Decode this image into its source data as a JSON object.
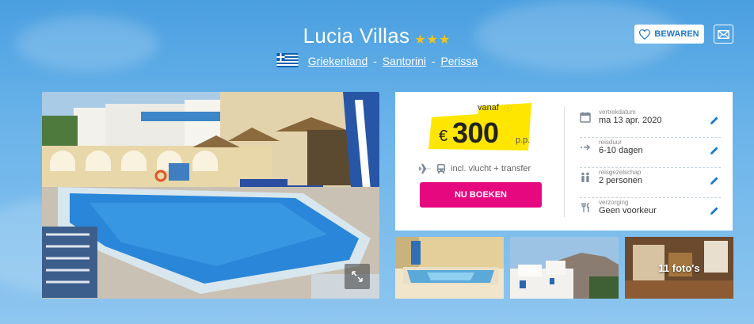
{
  "hotel": {
    "name": "Lucia Villas",
    "stars": "★★★",
    "location": {
      "country": "Griekenland",
      "region": "Santorini",
      "city": "Perissa",
      "separator": "-"
    }
  },
  "actions": {
    "save_label": "BEWAREN"
  },
  "price": {
    "from_label": "vanaf",
    "currency": "€",
    "amount": "300",
    "unit": "p.p.",
    "includes": "incl. vlucht + transfer",
    "book_label": "NU BOEKEN"
  },
  "details": [
    {
      "icon": "calendar-icon",
      "label": "vertrekdatum",
      "value": "ma 13 apr. 2020"
    },
    {
      "icon": "duration-arrow-icon",
      "label": "reisduur",
      "value": "6-10 dagen"
    },
    {
      "icon": "travelers-icon",
      "label": "reisgezelschap",
      "value": "2 personen"
    },
    {
      "icon": "cutlery-icon",
      "label": "verzorging",
      "value": "Geen voorkeur"
    }
  ],
  "gallery": {
    "photo_count_label": "11 foto's"
  },
  "colors": {
    "accent_pink": "#e5087e",
    "brand_blue": "#1a78c8",
    "price_yellow": "#ffe600",
    "star_gold": "#f5c518"
  }
}
